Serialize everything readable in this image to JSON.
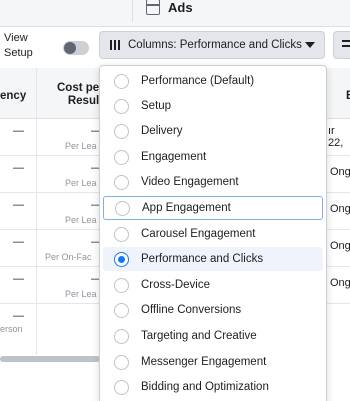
{
  "tabs": {
    "ads_label": "Ads"
  },
  "toolbar": {
    "view_setup_line1": "View",
    "view_setup_line2": "Setup",
    "columns_label": "Columns: Performance and Clicks"
  },
  "table": {
    "headers": {
      "frequency": "ency",
      "cost_line1": "Cost pe",
      "cost_line2": "Resul",
      "next": "B"
    },
    "rows": [
      {
        "freq": "—",
        "cost": "—",
        "cost_sub": "Per Lea",
        "next": "ır 22,"
      },
      {
        "freq": "—",
        "cost": "—",
        "cost_sub": "Per Lea",
        "next": "Ong"
      },
      {
        "freq": "—",
        "cost": "—",
        "cost_sub": "Per Lea",
        "next": "Ong"
      },
      {
        "freq": "—",
        "cost": "—",
        "cost_sub": "Per On-Fac",
        "next": "Ong"
      },
      {
        "freq": "—",
        "cost": "—",
        "cost_sub": "Per Lea",
        "next": "Ong"
      },
      {
        "freq": "—",
        "freq_sub": "erson",
        "cost": "",
        "cost_sub": "",
        "next": ""
      }
    ]
  },
  "dropdown": {
    "items": [
      {
        "label": "Performance (Default)"
      },
      {
        "label": "Setup"
      },
      {
        "label": "Delivery"
      },
      {
        "label": "Engagement"
      },
      {
        "label": "Video Engagement"
      },
      {
        "label": "App Engagement",
        "focused": true
      },
      {
        "label": "Carousel Engagement"
      },
      {
        "label": "Performance and Clicks",
        "checked": true
      },
      {
        "label": "Cross-Device"
      },
      {
        "label": "Offline Conversions"
      },
      {
        "label": "Targeting and Creative"
      },
      {
        "label": "Messenger Engagement"
      },
      {
        "label": "Bidding and Optimization"
      }
    ]
  },
  "colors": {
    "accent": "#1877f2",
    "selected_bg": "#eef3fc",
    "focus_border": "#7fb0e8"
  },
  "icons": [
    "ads-tab-icon",
    "columns-icon",
    "chevron-down-icon",
    "breakdown-icon",
    "radio-icon"
  ]
}
